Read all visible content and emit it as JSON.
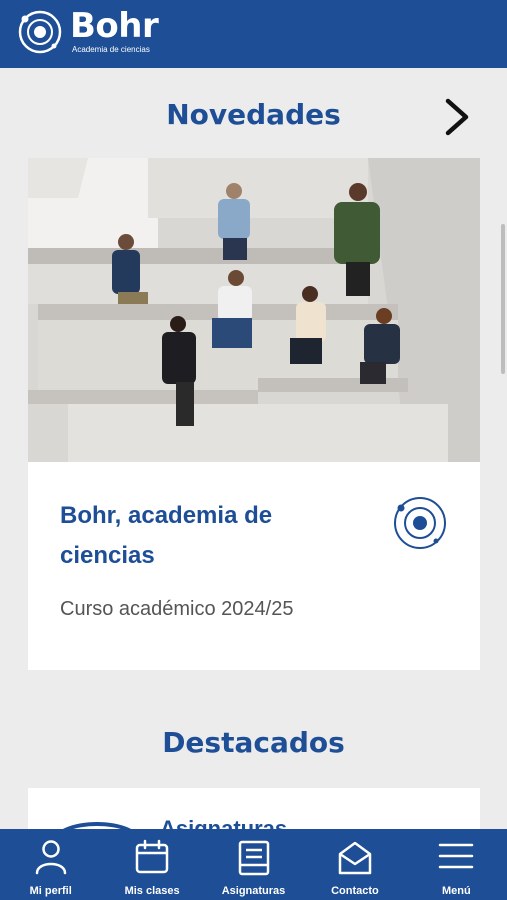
{
  "header": {
    "brand": "Bohr",
    "tagline": "Academia de ciencias"
  },
  "novedades": {
    "title": "Novedades",
    "card": {
      "title": "Bohr, academia de ciencias",
      "subtitle": "Curso académico 2024/25"
    }
  },
  "destacados": {
    "title": "Destacados",
    "card": {
      "title": "Asignaturas"
    }
  },
  "bottom_nav": [
    {
      "label": "Mi perfil",
      "icon": "user-icon"
    },
    {
      "label": "Mis clases",
      "icon": "calendar-icon"
    },
    {
      "label": "Asignaturas",
      "icon": "book-icon"
    },
    {
      "label": "Contacto",
      "icon": "mail-icon"
    },
    {
      "label": "Menú",
      "icon": "menu-icon"
    }
  ],
  "colors": {
    "brand": "#1d4e96",
    "background": "#ececec"
  }
}
